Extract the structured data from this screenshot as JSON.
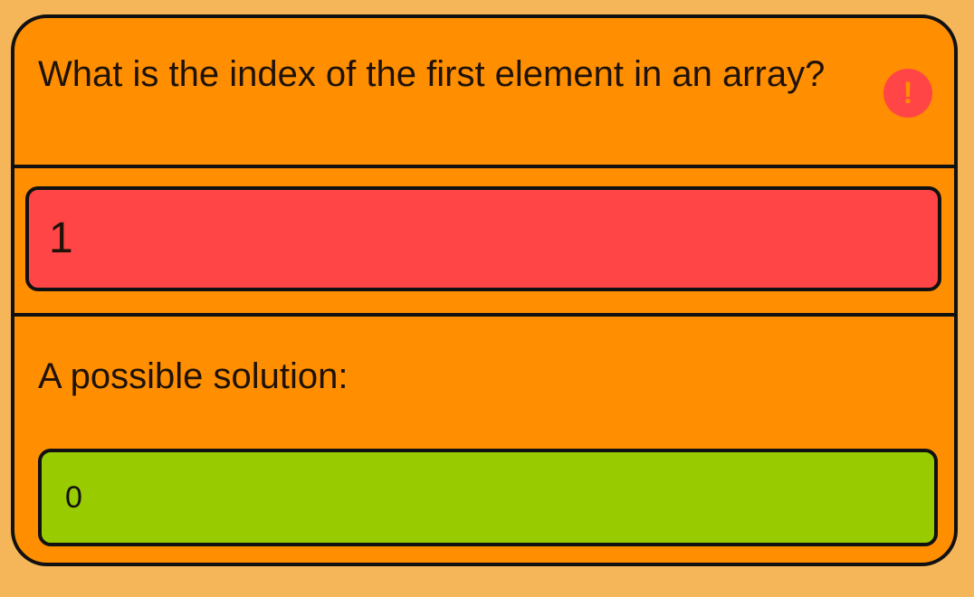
{
  "question": {
    "text": "What is the index of the first element in an array?",
    "status_icon": "exclamation-icon",
    "status_glyph": "!"
  },
  "answer": {
    "value": "1",
    "state": "incorrect",
    "color": "#FF4545"
  },
  "solution": {
    "label": "A possible solution:",
    "value": "0",
    "color": "#99CC00"
  },
  "colors": {
    "page_background": "#F5B65A",
    "card_background": "#FF8F00",
    "border": "#111111"
  }
}
